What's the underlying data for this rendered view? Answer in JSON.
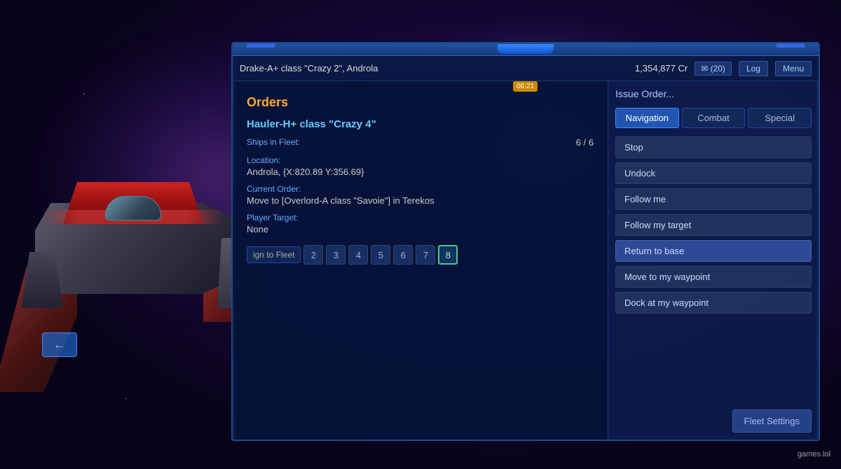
{
  "background": {
    "color": "#0a0520"
  },
  "header": {
    "ship_name": "Drake-A+ class \"Crazy 2\", Androla",
    "credits": "1,354,877 Cr",
    "mail_label": "✉ (20)",
    "log_label": "Log",
    "menu_label": "Menu",
    "time": "06:21"
  },
  "orders": {
    "title": "Orders",
    "fleet_name": "Hauler-H+ class \"Crazy 4\"",
    "ships_in_fleet_label": "Ships in Fleet:",
    "ships_in_fleet_value": "6 / 6",
    "location_label": "Location:",
    "location_value": "Androla, {X:820.89 Y:356.69}",
    "current_order_label": "Current Order:",
    "current_order_value": "Move to [Overlord-A class \"Savoie\"] in Terekos",
    "player_target_label": "Player Target:",
    "player_target_value": "None",
    "assign_label": "ign to Fleet",
    "fleet_numbers": [
      "2",
      "3",
      "4",
      "5",
      "6",
      "7",
      "8"
    ],
    "active_fleet": "8"
  },
  "issue_order": {
    "title": "Issue Order...",
    "tabs": [
      {
        "id": "navigation",
        "label": "Navigation",
        "active": true
      },
      {
        "id": "combat",
        "label": "Combat",
        "active": false
      },
      {
        "id": "special",
        "label": "Special",
        "active": false
      }
    ],
    "nav_buttons": [
      {
        "id": "stop",
        "label": "Stop"
      },
      {
        "id": "undock",
        "label": "Undock"
      },
      {
        "id": "follow-me",
        "label": "Follow me"
      },
      {
        "id": "follow-target",
        "label": "Follow my target"
      },
      {
        "id": "return-base",
        "label": "Return to base"
      },
      {
        "id": "move-waypoint",
        "label": "Move to my waypoint"
      },
      {
        "id": "dock-waypoint",
        "label": "Dock at my waypoint"
      }
    ],
    "fleet_settings_label": "Fleet Settings"
  },
  "watermark": "games.lol"
}
